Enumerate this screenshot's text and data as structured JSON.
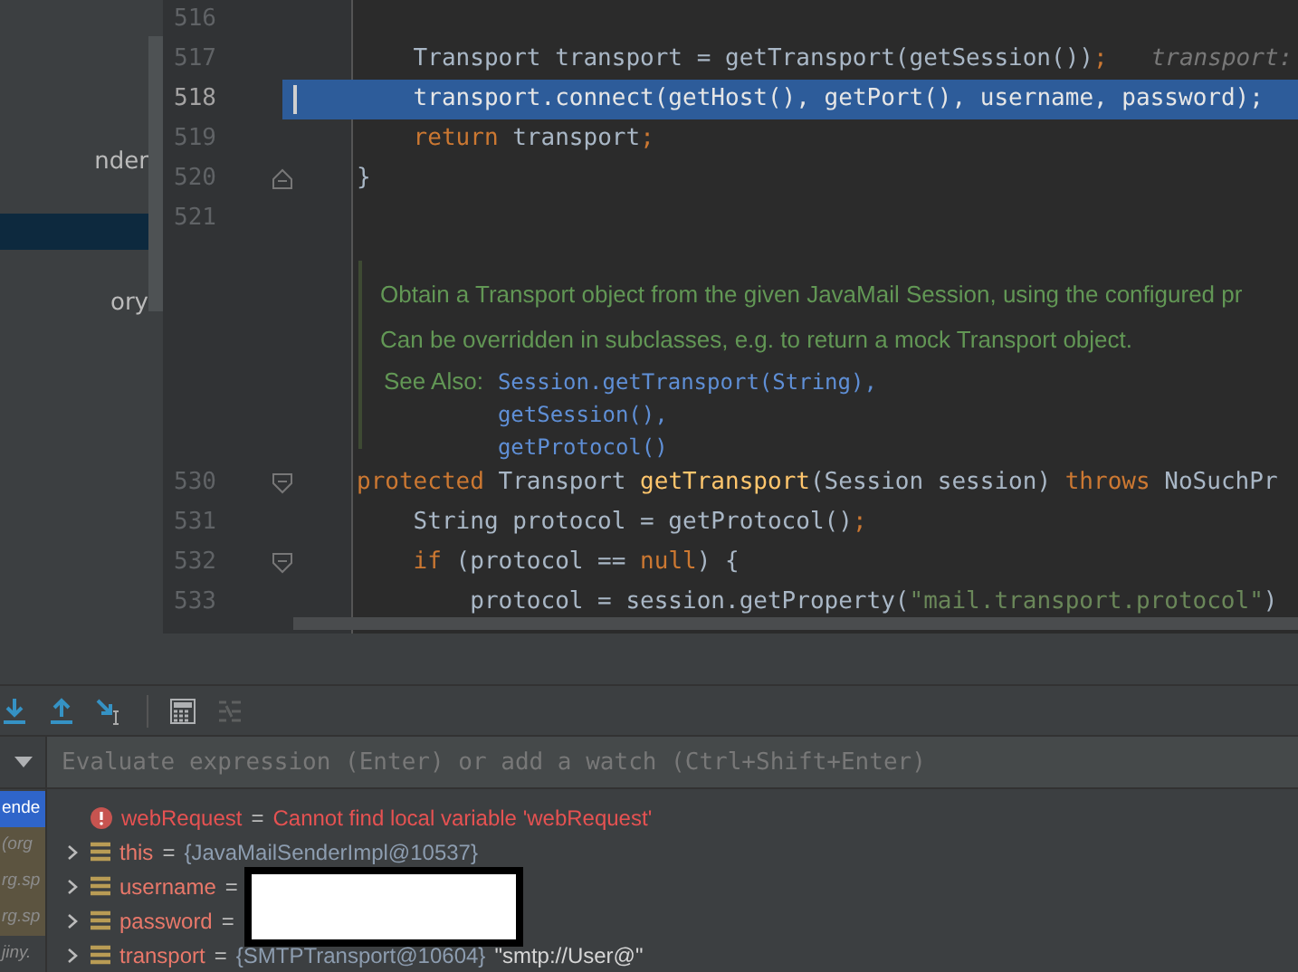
{
  "sidebar": {
    "items": [
      {
        "label": "nder",
        "selected": false
      },
      {
        "selected": true
      },
      {
        "label": "ory",
        "selected": false
      }
    ]
  },
  "editor": {
    "lines_before": [
      {
        "number": "516",
        "current": false
      },
      {
        "number": "517",
        "current": false,
        "tokens": [
          {
            "text": "    Transport transport = getTransport(getSession())",
            "kind": "plain"
          },
          {
            "text": ";",
            "kind": "punct"
          }
        ],
        "hint": "transport:"
      },
      {
        "number": "518",
        "current": true,
        "tokens": [
          {
            "text": "    transport.connect(getHost()",
            "kind": "plain"
          },
          {
            "text": ",",
            "kind": "punct"
          },
          {
            "text": " getPort()",
            "kind": "plain"
          },
          {
            "text": ",",
            "kind": "punct"
          },
          {
            "text": " username",
            "kind": "plain"
          },
          {
            "text": ",",
            "kind": "punct"
          },
          {
            "text": " password)",
            "kind": "plain"
          },
          {
            "text": ";",
            "kind": "punct"
          }
        ]
      },
      {
        "number": "519",
        "current": false,
        "tokens": [
          {
            "text": "    return",
            "kind": "keyword"
          },
          {
            "text": " transport",
            "kind": "plain"
          },
          {
            "text": ";",
            "kind": "punct"
          }
        ]
      },
      {
        "number": "520",
        "current": false,
        "fold_end": true,
        "tokens": [
          {
            "text": "}",
            "kind": "plain"
          }
        ]
      },
      {
        "number": "521",
        "current": false
      }
    ],
    "doc": {
      "paragraphs": [
        "Obtain a Transport object from the given JavaMail Session, using the configured pr",
        "Can be overridden in subclasses, e.g. to return a mock Transport object."
      ],
      "see_also_label": "See Also:",
      "links": [
        "Session.getTransport(String),",
        "getSession(),",
        "getProtocol()"
      ]
    },
    "lines_after": [
      {
        "number": "530",
        "current": false,
        "fold_start": true,
        "tokens": [
          {
            "text": "protected",
            "kind": "keyword"
          },
          {
            "text": " Transport ",
            "kind": "plain"
          },
          {
            "text": "getTransport",
            "kind": "method"
          },
          {
            "text": "(Session session) ",
            "kind": "plain"
          },
          {
            "text": "throws",
            "kind": "keyword"
          },
          {
            "text": " NoSuchPr",
            "kind": "plain"
          }
        ]
      },
      {
        "number": "531",
        "current": false,
        "tokens": [
          {
            "text": "    String protocol = getProtocol()",
            "kind": "plain"
          },
          {
            "text": ";",
            "kind": "punct"
          }
        ]
      },
      {
        "number": "532",
        "current": false,
        "fold_start": true,
        "tokens": [
          {
            "text": "    if",
            "kind": "keyword"
          },
          {
            "text": " (protocol == ",
            "kind": "plain"
          },
          {
            "text": "null",
            "kind": "keyword"
          },
          {
            "text": ") {",
            "kind": "plain"
          }
        ]
      },
      {
        "number": "533",
        "current": false,
        "tokens": [
          {
            "text": "        protocol = session.getProperty(",
            "kind": "plain"
          },
          {
            "text": "\"mail.transport.protocol\"",
            "kind": "string"
          },
          {
            "text": ")",
            "kind": "plain"
          }
        ]
      }
    ]
  },
  "debugger": {
    "watch": {
      "placeholder": "Evaluate expression (Enter) or add a watch (Ctrl+Shift+Enter)"
    },
    "frames": [
      {
        "label": "ende",
        "selected": true,
        "kind": "current"
      },
      {
        "label": "(org",
        "selected": false,
        "kind": "library"
      },
      {
        "label": "rg.sp",
        "selected": false,
        "kind": "library"
      },
      {
        "label": "rg.sp",
        "selected": false,
        "kind": "library"
      },
      {
        "label": "jiny.",
        "selected": false,
        "kind": "frame"
      }
    ],
    "variables": [
      {
        "kind": "error",
        "name": "webRequest",
        "op": "=",
        "value": "Cannot find local variable 'webRequest'"
      },
      {
        "kind": "field",
        "name": "this",
        "op": "=",
        "value": "{JavaMailSenderImpl@10537}",
        "expanded": false
      },
      {
        "kind": "field",
        "name": "username",
        "op": "=",
        "expanded": false
      },
      {
        "kind": "field",
        "name": "password",
        "op": "=",
        "expanded": false
      },
      {
        "kind": "field",
        "name": "transport",
        "op": "=",
        "value": "{SMTPTransport@10604}",
        "extra": "\"smtp://User@\"",
        "expanded": false
      }
    ],
    "redacted": true
  }
}
